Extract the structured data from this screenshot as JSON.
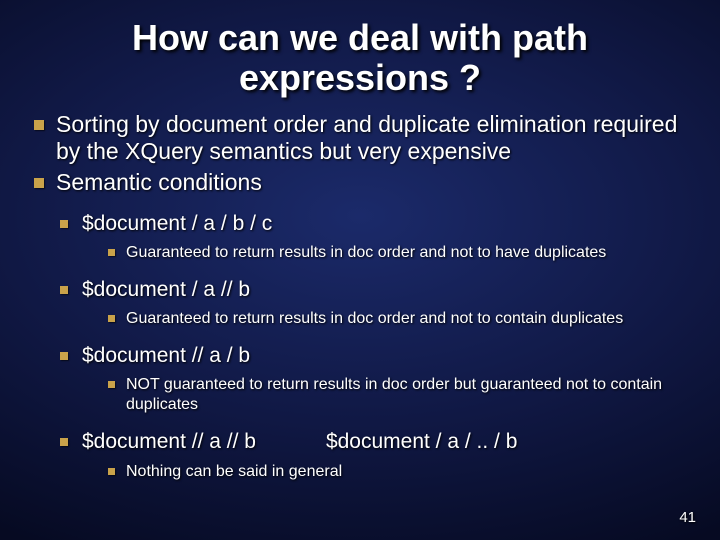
{
  "title": "How can we deal with path expressions ?",
  "bullets": {
    "p1": "Sorting by document order and duplicate elimination required by the XQuery semantics but very expensive",
    "p2": "Semantic conditions"
  },
  "cases": {
    "c1": {
      "expr": "$document / a / b / c",
      "note": "Guaranteed to return results in doc order and not to have duplicates"
    },
    "c2": {
      "expr": "$document / a // b",
      "note": "Guaranteed to return results in doc order and not to contain duplicates"
    },
    "c3": {
      "expr": "$document // a / b",
      "note": "NOT guaranteed to return results in doc order but guaranteed not to contain duplicates"
    },
    "c4": {
      "expr_a": "$document // a // b",
      "expr_b": "$document / a / .. / b",
      "note": "Nothing can be said in general"
    }
  },
  "pagenum": "41"
}
